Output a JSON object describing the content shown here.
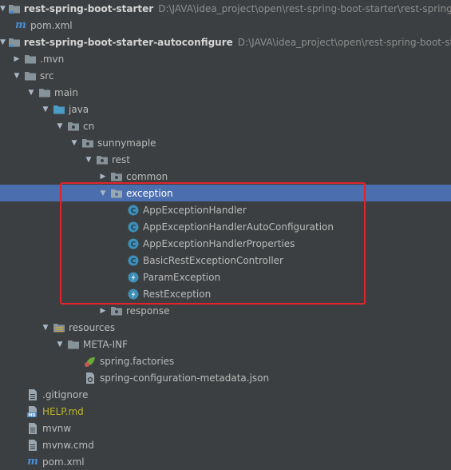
{
  "tree": [
    {
      "label": "rest-spring-boot-starter",
      "path": "D:\\JAVA\\idea_project\\open\\rest-spring-boot-starter\\rest-spring-b",
      "icon": "module-folder-icon",
      "arrow": "down"
    },
    {
      "label": "pom.xml",
      "icon": "maven-icon"
    },
    {
      "label": "rest-spring-boot-starter-autoconfigure",
      "path": "D:\\JAVA\\idea_project\\open\\rest-spring-boot-starter",
      "icon": "module-folder-icon",
      "arrow": "down"
    },
    {
      "label": ".mvn",
      "icon": "folder-icon",
      "arrow": "right"
    },
    {
      "label": "src",
      "icon": "folder-icon",
      "arrow": "down"
    },
    {
      "label": "main",
      "icon": "folder-icon",
      "arrow": "down"
    },
    {
      "label": "java",
      "icon": "source-folder-icon",
      "arrow": "down"
    },
    {
      "label": "cn",
      "icon": "package-icon",
      "arrow": "down"
    },
    {
      "label": "sunnymaple",
      "icon": "package-icon",
      "arrow": "down"
    },
    {
      "label": "rest",
      "icon": "package-icon",
      "arrow": "down"
    },
    {
      "label": "common",
      "icon": "package-icon",
      "arrow": "right"
    },
    {
      "label": "exception",
      "icon": "package-icon",
      "arrow": "down"
    },
    {
      "label": "AppExceptionHandler",
      "icon": "class-icon"
    },
    {
      "label": "AppExceptionHandlerAutoConfiguration",
      "icon": "class-icon"
    },
    {
      "label": "AppExceptionHandlerProperties",
      "icon": "class-icon"
    },
    {
      "label": "BasicRestExceptionController",
      "icon": "class-icon"
    },
    {
      "label": "ParamException",
      "icon": "exception-class-icon"
    },
    {
      "label": "RestException",
      "icon": "exception-class-icon"
    },
    {
      "label": "response",
      "icon": "package-icon",
      "arrow": "right"
    },
    {
      "label": "resources",
      "icon": "resources-folder-icon",
      "arrow": "down"
    },
    {
      "label": "META-INF",
      "icon": "folder-icon",
      "arrow": "down"
    },
    {
      "label": "spring.factories",
      "icon": "spring-icon"
    },
    {
      "label": "spring-configuration-metadata.json",
      "icon": "json-file-icon"
    },
    {
      "label": ".gitignore",
      "icon": "text-file-icon"
    },
    {
      "label": "HELP.md",
      "icon": "markdown-file-icon"
    },
    {
      "label": "mvnw",
      "icon": "text-file-icon"
    },
    {
      "label": "mvnw.cmd",
      "icon": "text-file-icon"
    },
    {
      "label": "pom.xml",
      "icon": "maven-icon"
    }
  ]
}
